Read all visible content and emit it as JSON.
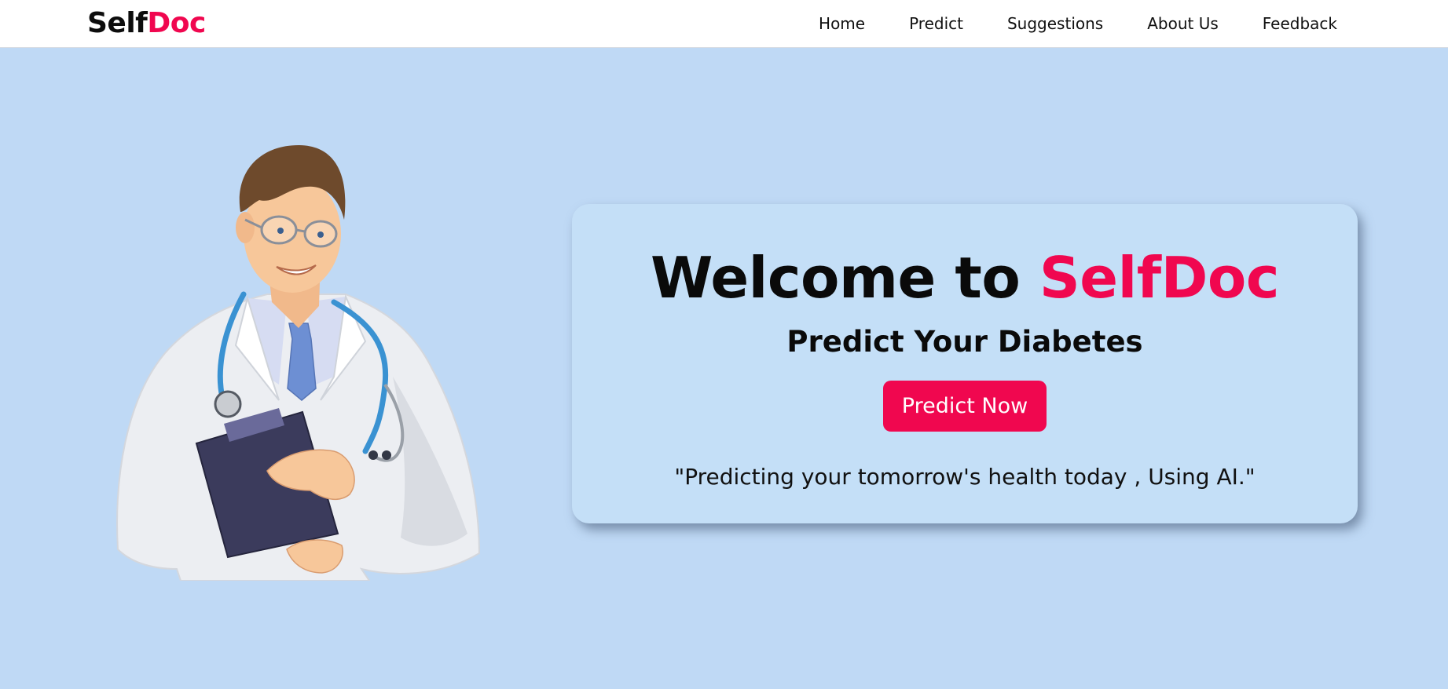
{
  "brand": {
    "part1": "Self",
    "part2": "Doc"
  },
  "nav": {
    "home": "Home",
    "predict": "Predict",
    "suggestions": "Suggestions",
    "about": "About Us",
    "feedback": "Feedback"
  },
  "hero": {
    "title_prefix": "Welcome to ",
    "title_accent": "SelfDoc",
    "subtitle": "Predict Your Diabetes",
    "button_label": "Predict Now",
    "tagline": "\"Predicting your tomorrow's health today , Using AI.\""
  },
  "illustration": {
    "icon": "doctor-illustration"
  },
  "colors": {
    "accent": "#f0074f",
    "background": "#bfd9f5",
    "card": "#c4dff7",
    "navbar": "#ffffff",
    "text": "#0a0a0a"
  }
}
